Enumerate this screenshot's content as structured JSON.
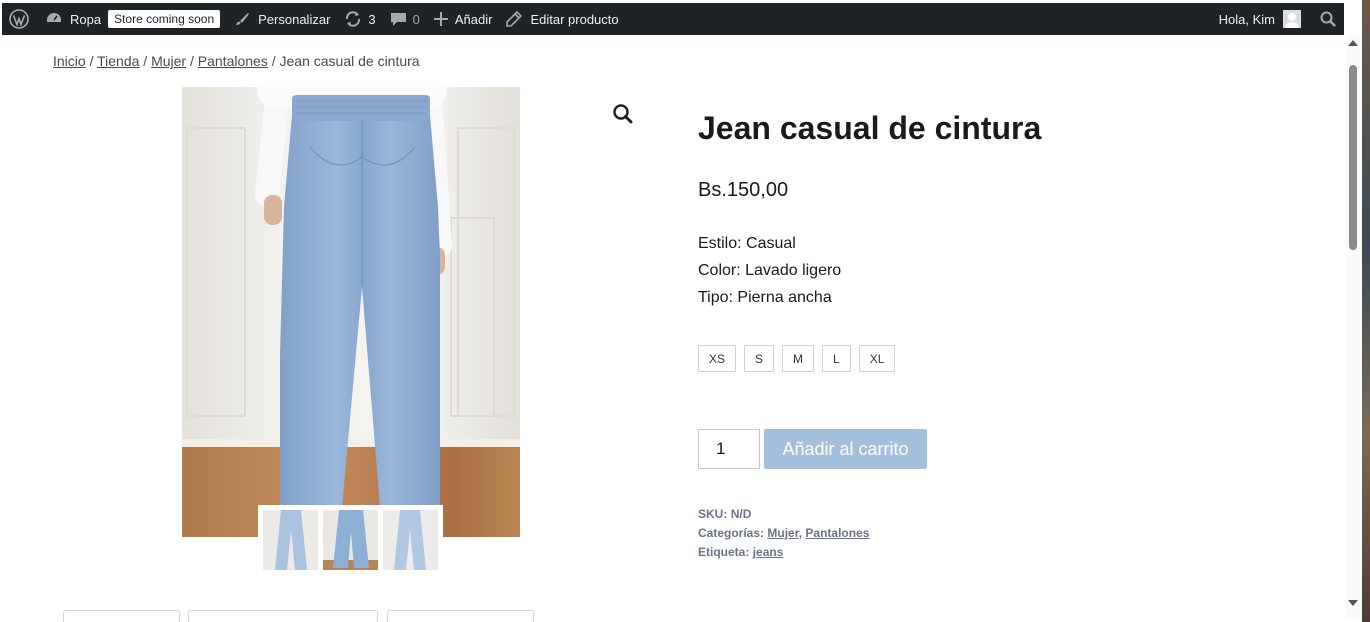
{
  "adminbar": {
    "site_name": "Ropa",
    "coming_soon": "Store coming soon",
    "customize": "Personalizar",
    "updates_count": "3",
    "comments_count": "0",
    "add_new": "Añadir",
    "edit_product": "Editar producto",
    "greeting": "Hola, Kim"
  },
  "breadcrumb": {
    "items": [
      "Inicio",
      "Tienda",
      "Mujer",
      "Pantalones"
    ],
    "separator": " / ",
    "current": "Jean casual de cintura"
  },
  "product": {
    "title": "Jean casual de cintura",
    "price": "Bs.150,00",
    "attributes": [
      "Estilo: Casual",
      "Color: Lavado ligero",
      "Tipo: Pierna ancha"
    ],
    "sizes": [
      "XS",
      "S",
      "M",
      "L",
      "XL"
    ],
    "quantity": "1",
    "add_to_cart": "Añadir al carrito",
    "sku_label": "SKU:",
    "sku_value": "N/D",
    "categories_label": "Categorías:",
    "categories": [
      "Mujer",
      "Pantalones"
    ],
    "tag_label": "Etiqueta:",
    "tag": "jeans"
  },
  "icons": {
    "wordpress": "wordpress-logo-icon",
    "dashboard": "dashboard-icon",
    "brush": "brush-icon",
    "updates": "refresh-icon",
    "comments": "comment-icon",
    "add": "plus-icon",
    "edit": "pencil-icon",
    "search": "search-icon",
    "zoom": "magnifier-icon"
  },
  "colors": {
    "adminbar_bg": "#1d2327",
    "button_bg": "#a4bfdc",
    "meta_text": "#6a7288"
  }
}
